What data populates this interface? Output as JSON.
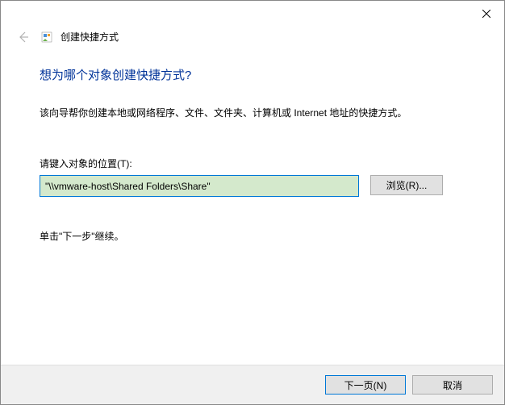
{
  "window": {
    "wizard_name": "创建快捷方式"
  },
  "heading": "想为哪个对象创建快捷方式?",
  "description": "该向导帮你创建本地或网络程序、文件、文件夹、计算机或 Internet 地址的快捷方式。",
  "field": {
    "label": "请键入对象的位置(T):",
    "value": "\"\\\\vmware-host\\Shared Folders\\Share\"",
    "browse_label": "浏览(R)..."
  },
  "continue_text": "单击\"下一步\"继续。",
  "footer": {
    "next_label": "下一页(N)",
    "cancel_label": "取消"
  }
}
